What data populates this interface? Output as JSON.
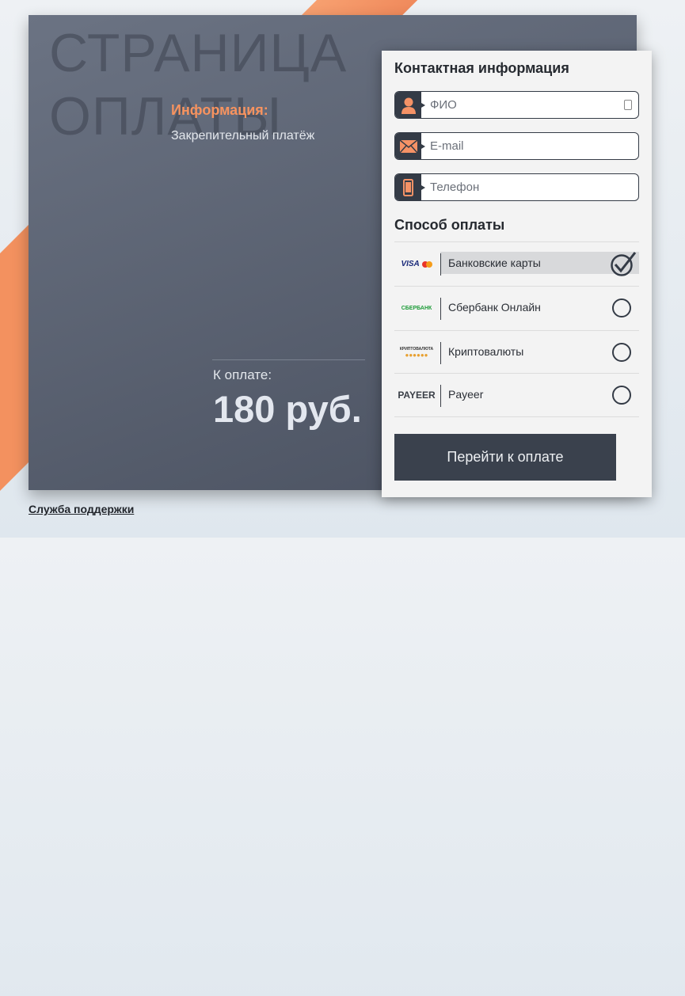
{
  "watermark": [
    "СТРАНИЦА",
    "ОПЛАТЫ"
  ],
  "info": {
    "heading": "Информация:",
    "text": "Закрепительный платёж"
  },
  "payment": {
    "label": "К оплате:",
    "amount": "180 руб."
  },
  "contact": {
    "title": "Контактная информация",
    "fields": [
      {
        "placeholder": "ФИО",
        "icon": "user-icon"
      },
      {
        "placeholder": "E-mail",
        "icon": "envelope-icon"
      },
      {
        "placeholder": "Телефон",
        "icon": "phone-icon"
      }
    ]
  },
  "methods": {
    "title": "Способ оплаты",
    "items": [
      {
        "label": "Банковские карты",
        "logo": "VISA",
        "selected": true
      },
      {
        "label": "Сбербанк Онлайн",
        "logo": "СБЕРБАНК",
        "selected": false
      },
      {
        "label": "Криптовалюты",
        "logo": "КРИПТОВАЛЮТА",
        "selected": false
      },
      {
        "label": "Payeer",
        "logo": "PAYEER",
        "selected": false
      }
    ]
  },
  "submit": "Перейти к оплате",
  "support": "Служба поддержки",
  "colors": {
    "accent": "#f7935f",
    "dark": "#343b46"
  }
}
